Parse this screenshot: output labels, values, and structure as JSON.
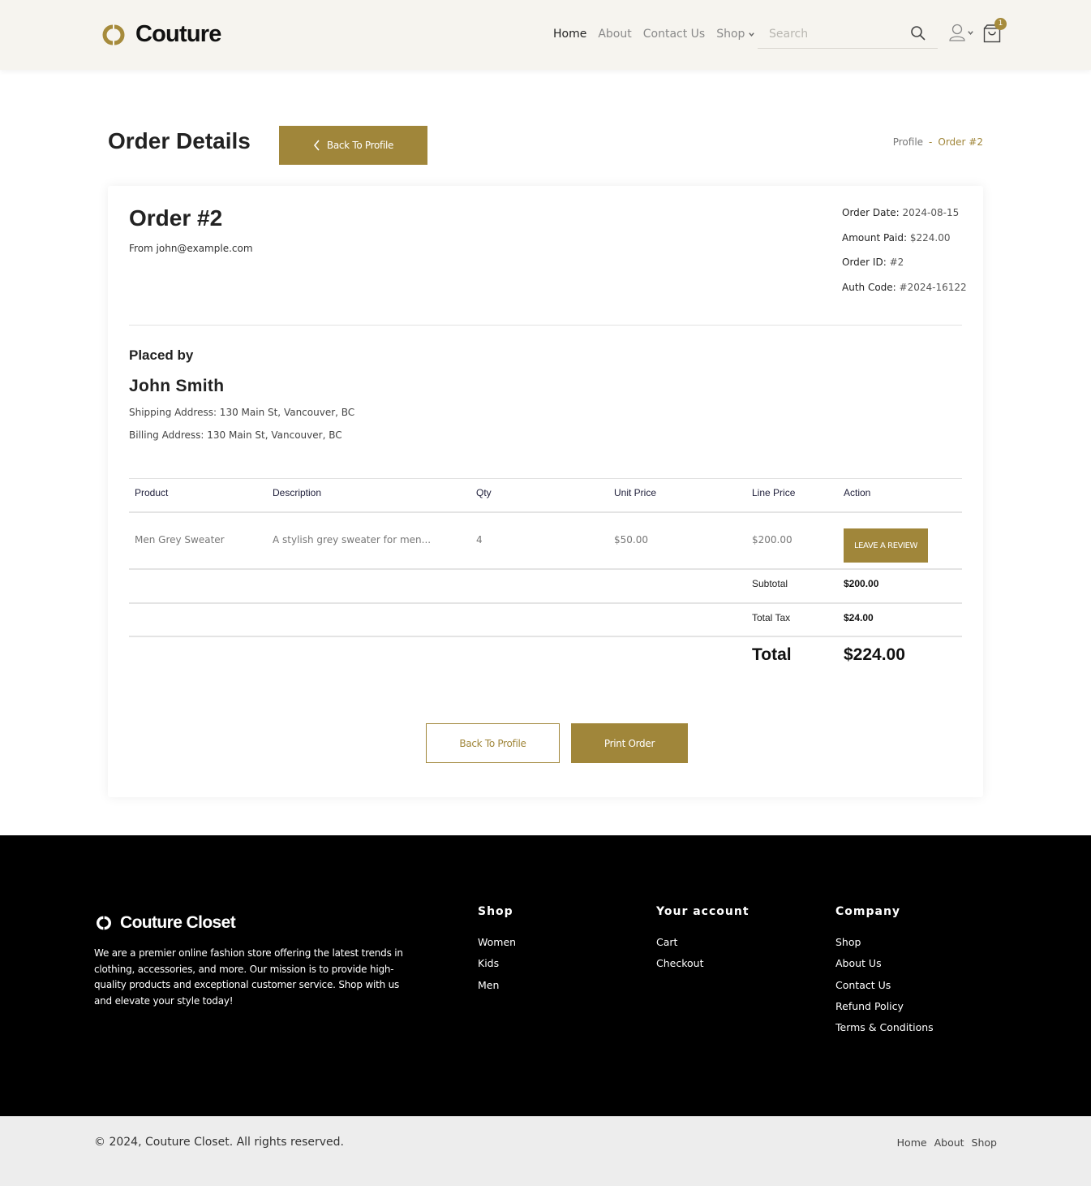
{
  "header": {
    "logo_text": "Couture",
    "nav": {
      "home": "Home",
      "about": "About",
      "contact": "Contact Us",
      "shop": "Shop"
    },
    "search_placeholder": "Search",
    "cart_count": "1",
    "icons": [
      "couture-logo-icon",
      "chevron-down-icon",
      "search-icon",
      "user-icon",
      "shopping-bag-icon"
    ]
  },
  "page": {
    "title": "Order Details",
    "back_button": "Back To Profile",
    "breadcrumb": {
      "profile": "Profile",
      "separator": "-",
      "current": "Order #2"
    }
  },
  "order": {
    "title": "Order #2",
    "from": "From john@example.com",
    "meta": [
      {
        "label": "Order Date:",
        "value": "2024-08-15"
      },
      {
        "label": "Amount Paid:",
        "value": "$224.00"
      },
      {
        "label": "Order ID:",
        "value": "#2"
      },
      {
        "label": "Auth Code:",
        "value": "#2024-16122"
      }
    ],
    "placed_by_label": "Placed by",
    "customer_name": "John Smith",
    "shipping_address": "Shipping Address: 130 Main St, Vancouver, BC",
    "billing_address": "Billing Address: 130 Main St, Vancouver, BC"
  },
  "table": {
    "headers": [
      "Product",
      "Description",
      "Qty",
      "Unit Price",
      "Line Price",
      "Action"
    ],
    "rows": [
      {
        "product": "Men Grey Sweater",
        "description": "A stylish grey sweater for men...",
        "qty": "4",
        "unit_price": "$50.00",
        "line_price": "$200.00",
        "action": "LEAVE A REVIEW"
      }
    ],
    "subtotal_label": "Subtotal",
    "subtotal_value": "$200.00",
    "tax_label": "Total Tax",
    "tax_value": "$24.00",
    "total_label": "Total",
    "total_value": "$224.00"
  },
  "actions": {
    "back": "Back To Profile",
    "print": "Print Order"
  },
  "footer": {
    "brand": "Couture Closet",
    "about": "We are a premier online fashion store offering the latest trends in clothing, accessories, and more. Our mission is to provide high-quality products and exceptional customer service. Shop with us and elevate your style today!",
    "columns": {
      "shop": {
        "title": "Shop",
        "links": [
          "Women",
          "Kids",
          "Men"
        ]
      },
      "account": {
        "title": "Your account",
        "links": [
          "Cart",
          "Checkout"
        ]
      },
      "company": {
        "title": "Company",
        "links": [
          "Shop",
          "About Us",
          "Contact Us",
          "Refund Policy",
          "Terms & Conditions"
        ]
      }
    },
    "copyright": "© 2024, Couture Closet. All rights reserved.",
    "bottom_links": [
      "Home",
      "About",
      "Shop"
    ]
  },
  "colors": {
    "accent": "#a0863a",
    "header_bg": "#f6f4ef",
    "footer_bg": "#000000",
    "subfooter_bg": "#ededed"
  }
}
